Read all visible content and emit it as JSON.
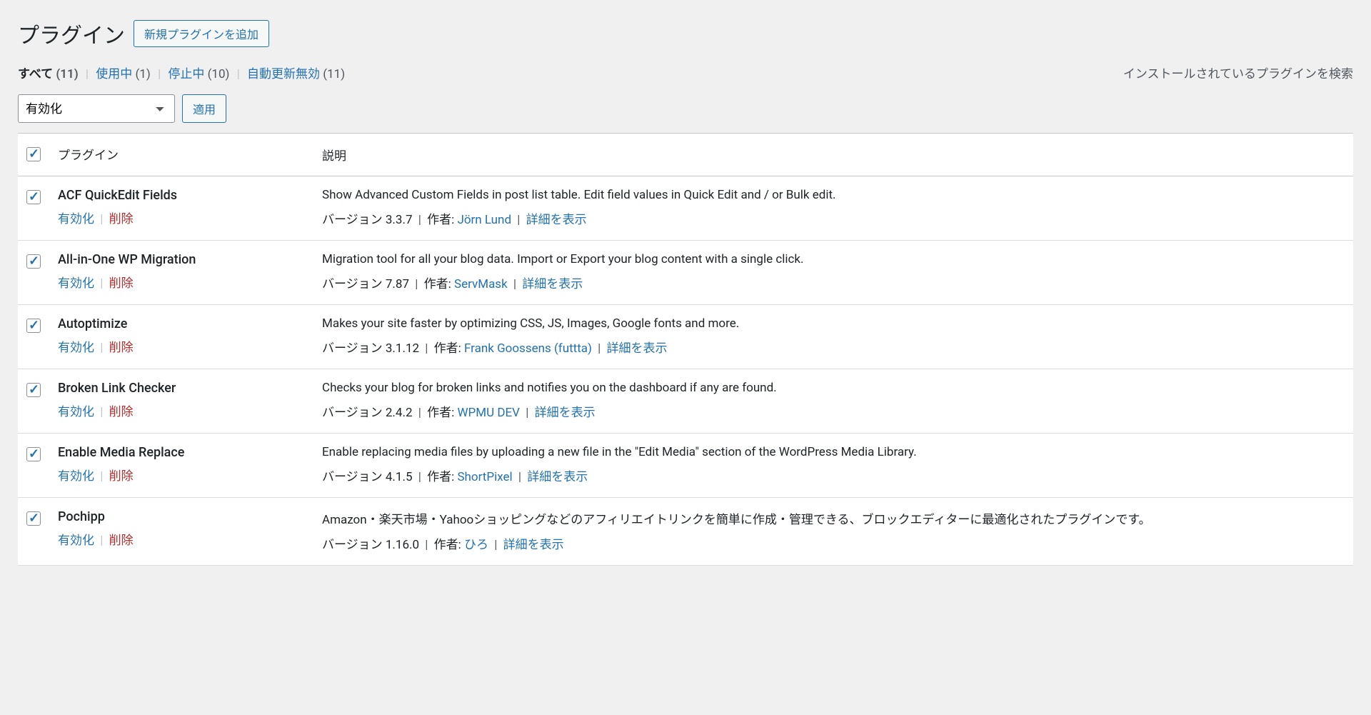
{
  "header": {
    "title": "プラグイン",
    "add_new": "新規プラグインを追加"
  },
  "filters": {
    "all_label": "すべて",
    "all_count": "(11)",
    "active_label": "使用中",
    "active_count": "(1)",
    "inactive_label": "停止中",
    "inactive_count": "(10)",
    "autoupdate_label": "自動更新無効",
    "autoupdate_count": "(11)",
    "search_label": "インストールされているプラグインを検索"
  },
  "bulk": {
    "selected": "有効化",
    "apply": "適用"
  },
  "table": {
    "col_plugin": "プラグイン",
    "col_desc": "説明",
    "action_activate": "有効化",
    "action_delete": "削除",
    "version_label": "バージョン",
    "author_label": "作者:",
    "detail_label": "詳細を表示"
  },
  "plugins": [
    {
      "name": "ACF QuickEdit Fields",
      "desc": "Show Advanced Custom Fields in post list table. Edit field values in Quick Edit and / or Bulk edit.",
      "version": "3.3.7",
      "author": "Jörn Lund"
    },
    {
      "name": "All-in-One WP Migration",
      "desc": "Migration tool for all your blog data. Import or Export your blog content with a single click.",
      "version": "7.87",
      "author": "ServMask"
    },
    {
      "name": "Autoptimize",
      "desc": "Makes your site faster by optimizing CSS, JS, Images, Google fonts and more.",
      "version": "3.1.12",
      "author": "Frank Goossens (futtta)"
    },
    {
      "name": "Broken Link Checker",
      "desc": "Checks your blog for broken links and notifies you on the dashboard if any are found.",
      "version": "2.4.2",
      "author": "WPMU DEV"
    },
    {
      "name": "Enable Media Replace",
      "desc": "Enable replacing media files by uploading a new file in the \"Edit Media\" section of the WordPress Media Library.",
      "version": "4.1.5",
      "author": "ShortPixel"
    },
    {
      "name": "Pochipp",
      "desc": "Amazon・楽天市場・Yahooショッピングなどのアフィリエイトリンクを簡単に作成・管理できる、ブロックエディターに最適化されたプラグインです。",
      "version": "1.16.0",
      "author": "ひろ"
    }
  ]
}
